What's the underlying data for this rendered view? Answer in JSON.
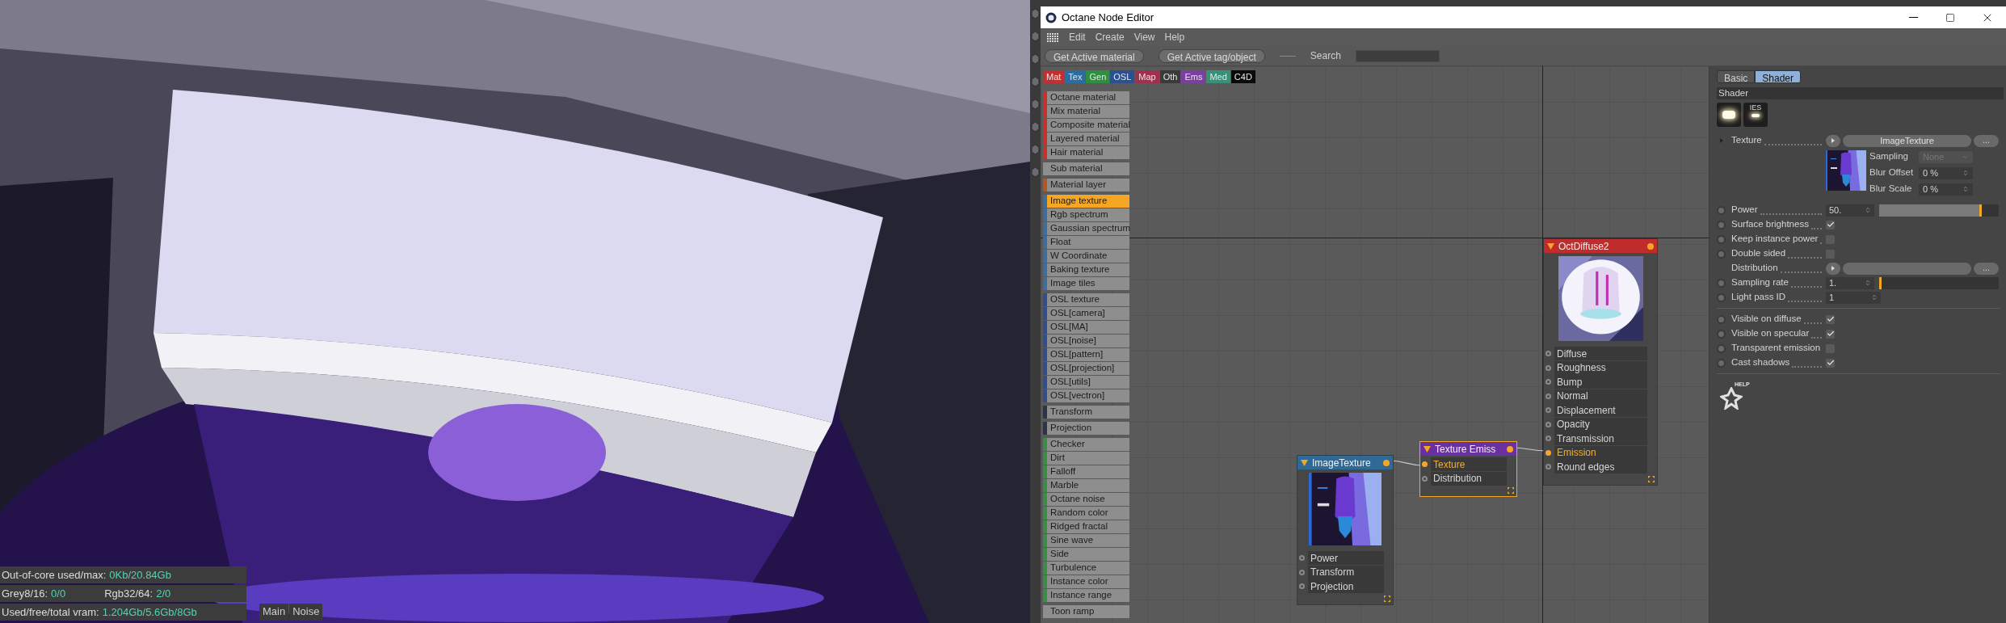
{
  "viewport": {
    "kind": "picture",
    "stats": [
      {
        "items": [
          {
            "label": "Out-of-core used/max:",
            "value": "0Kb/20.84Gb"
          }
        ]
      },
      {
        "items": [
          {
            "label": "Grey8/16:",
            "value": "0/0"
          },
          {
            "label": "Rgb32/64:",
            "value": "2/0"
          }
        ]
      },
      {
        "items": [
          {
            "label": "Used/free/total vram:",
            "value": "1.204Gb/5.6Gb/8Gb"
          }
        ]
      }
    ],
    "buttons": [
      "Main",
      "Noise"
    ]
  },
  "window": {
    "title": "Octane Node Editor"
  },
  "menu": [
    "Edit",
    "Create",
    "View",
    "Help"
  ],
  "toolbar": {
    "buttons": [
      "Get Active material",
      "Get Active tag/object"
    ],
    "search_label": "Search"
  },
  "categories": [
    {
      "label": "Mat",
      "color": "#c0302f"
    },
    {
      "label": "Tex",
      "color": "#2e6b9e"
    },
    {
      "label": "Gen",
      "color": "#2f8f3f"
    },
    {
      "label": "OSL",
      "color": "#2c4f8f"
    },
    {
      "label": "Map",
      "color": "#a03050"
    },
    {
      "label": "Oth",
      "color": "#3a3a3a"
    },
    {
      "label": "Ems",
      "color": "#7b3fa0"
    },
    {
      "label": "Med",
      "color": "#3a8f7a"
    },
    {
      "label": "C4D",
      "color": "#0a0a0a"
    }
  ],
  "node_list": [
    {
      "color": "#c8302c",
      "items": [
        {
          "label": "Octane material",
          "selected": false
        },
        {
          "label": "Mix material",
          "selected": false
        },
        {
          "label": "Composite material",
          "selected": false
        },
        {
          "label": "Layered material",
          "selected": false
        },
        {
          "label": "Hair material",
          "selected": false
        }
      ]
    },
    {
      "items": [
        {
          "label": "Sub material",
          "selected": false
        }
      ]
    },
    {
      "color": "#b5561c",
      "items": [
        {
          "label": "Material layer",
          "selected": false
        }
      ]
    },
    {
      "color": "#3a6e9e",
      "items": [
        {
          "label": "Image texture",
          "selected": true
        },
        {
          "label": "Rgb spectrum",
          "selected": false
        },
        {
          "label": "Gaussian spectrum",
          "selected": false
        },
        {
          "label": "Float",
          "selected": false
        },
        {
          "label": "W Coordinate",
          "selected": false
        },
        {
          "label": "Baking texture",
          "selected": false
        },
        {
          "label": "Image tiles",
          "selected": false
        }
      ]
    },
    {
      "color": "#2f4d8f",
      "items": [
        {
          "label": "OSL texture",
          "selected": false
        },
        {
          "label": "OSL[camera]",
          "selected": false
        },
        {
          "label": "OSL[MA]",
          "selected": false
        },
        {
          "label": "OSL[noise]",
          "selected": false
        },
        {
          "label": "OSL[pattern]",
          "selected": false
        },
        {
          "label": "OSL[projection]",
          "selected": false
        },
        {
          "label": "OSL[utils]",
          "selected": false
        },
        {
          "label": "OSL[vectron]",
          "selected": false
        }
      ]
    },
    {
      "color": "#2e3447",
      "items": [
        {
          "label": "Transform",
          "selected": false
        }
      ]
    },
    {
      "color": "#2e3447",
      "items": [
        {
          "label": "Projection",
          "selected": false
        }
      ]
    },
    {
      "color": "#3a8f45",
      "items": [
        {
          "label": "Checker",
          "selected": false
        },
        {
          "label": "Dirt",
          "selected": false
        },
        {
          "label": "Falloff",
          "selected": false
        },
        {
          "label": "Marble",
          "selected": false
        },
        {
          "label": "Octane noise",
          "selected": false
        },
        {
          "label": "Random color",
          "selected": false
        },
        {
          "label": "Ridged fractal",
          "selected": false
        },
        {
          "label": "Sine wave",
          "selected": false
        },
        {
          "label": "Side",
          "selected": false
        },
        {
          "label": "Turbulence",
          "selected": false
        },
        {
          "label": "Instance color",
          "selected": false
        },
        {
          "label": "Instance range",
          "selected": false
        }
      ]
    },
    {
      "items": [
        {
          "label": "Toon ramp",
          "selected": false
        }
      ]
    }
  ],
  "nodes": [
    {
      "title": "ImageTexture",
      "color": "#2f6a97",
      "selected": false,
      "thumbnail": {
        "kind": "picture"
      },
      "ports": [
        {
          "label": "Power",
          "connected": false
        },
        {
          "label": "Transform",
          "connected": false
        },
        {
          "label": "Projection",
          "connected": false
        }
      ]
    },
    {
      "title": "Texture Emiss",
      "color": "#6a2fa0",
      "selected": true,
      "ports": [
        {
          "label": "Texture",
          "connected": true
        },
        {
          "label": "Distribution",
          "connected": false
        }
      ]
    },
    {
      "title": "OctDiffuse2",
      "color": "#c02b2b",
      "selected": false,
      "thumbnail": {
        "kind": "picture"
      },
      "ports": [
        {
          "label": "Diffuse",
          "connected": false
        },
        {
          "label": "Roughness",
          "connected": false
        },
        {
          "label": "Bump",
          "connected": false
        },
        {
          "label": "Normal",
          "connected": false
        },
        {
          "label": "Displacement",
          "connected": false
        },
        {
          "label": "Opacity",
          "connected": false
        },
        {
          "label": "Transmission",
          "connected": false
        },
        {
          "label": "Emission",
          "connected": true
        },
        {
          "label": "Round edges",
          "connected": false
        }
      ]
    }
  ],
  "inspector": {
    "tabs": [
      {
        "label": "Basic",
        "selected": false
      },
      {
        "label": "Shader",
        "selected": true
      }
    ],
    "section": "Shader",
    "ies_label": "IES",
    "texture": {
      "label": "Texture",
      "value": "ImageTexture",
      "more": "...",
      "fields": [
        {
          "kind": "dropdown",
          "label": "Sampling",
          "value": "None",
          "disabled": true
        },
        {
          "kind": "number",
          "label": "Blur Offset",
          "value": "0 %",
          "disabled": false
        },
        {
          "kind": "number",
          "label": "Blur Scale",
          "value": "0 %",
          "disabled": false
        }
      ]
    },
    "params": [
      {
        "kind": "slider",
        "label": "Power",
        "value": "50.",
        "level": 0.86
      },
      {
        "kind": "checkbox",
        "label": "Surface brightness",
        "checked": true
      },
      {
        "kind": "checkbox",
        "label": "Keep instance power",
        "checked": false
      },
      {
        "kind": "checkbox",
        "label": "Double sided",
        "checked": false
      },
      {
        "kind": "link",
        "label": "Distribution",
        "more": "..."
      },
      {
        "kind": "slider",
        "label": "Sampling rate",
        "value": "1.",
        "level": 0
      },
      {
        "kind": "number",
        "label": "Light pass ID",
        "value": "1"
      }
    ],
    "visibility": [
      {
        "kind": "checkbox",
        "label": "Visible on diffuse",
        "checked": true
      },
      {
        "kind": "checkbox",
        "label": "Visible on specular",
        "checked": true
      },
      {
        "kind": "checkbox",
        "label": "Transparent emission",
        "checked": false
      },
      {
        "kind": "checkbox",
        "label": "Cast shadows",
        "checked": true
      }
    ],
    "help_label": "HELP"
  }
}
